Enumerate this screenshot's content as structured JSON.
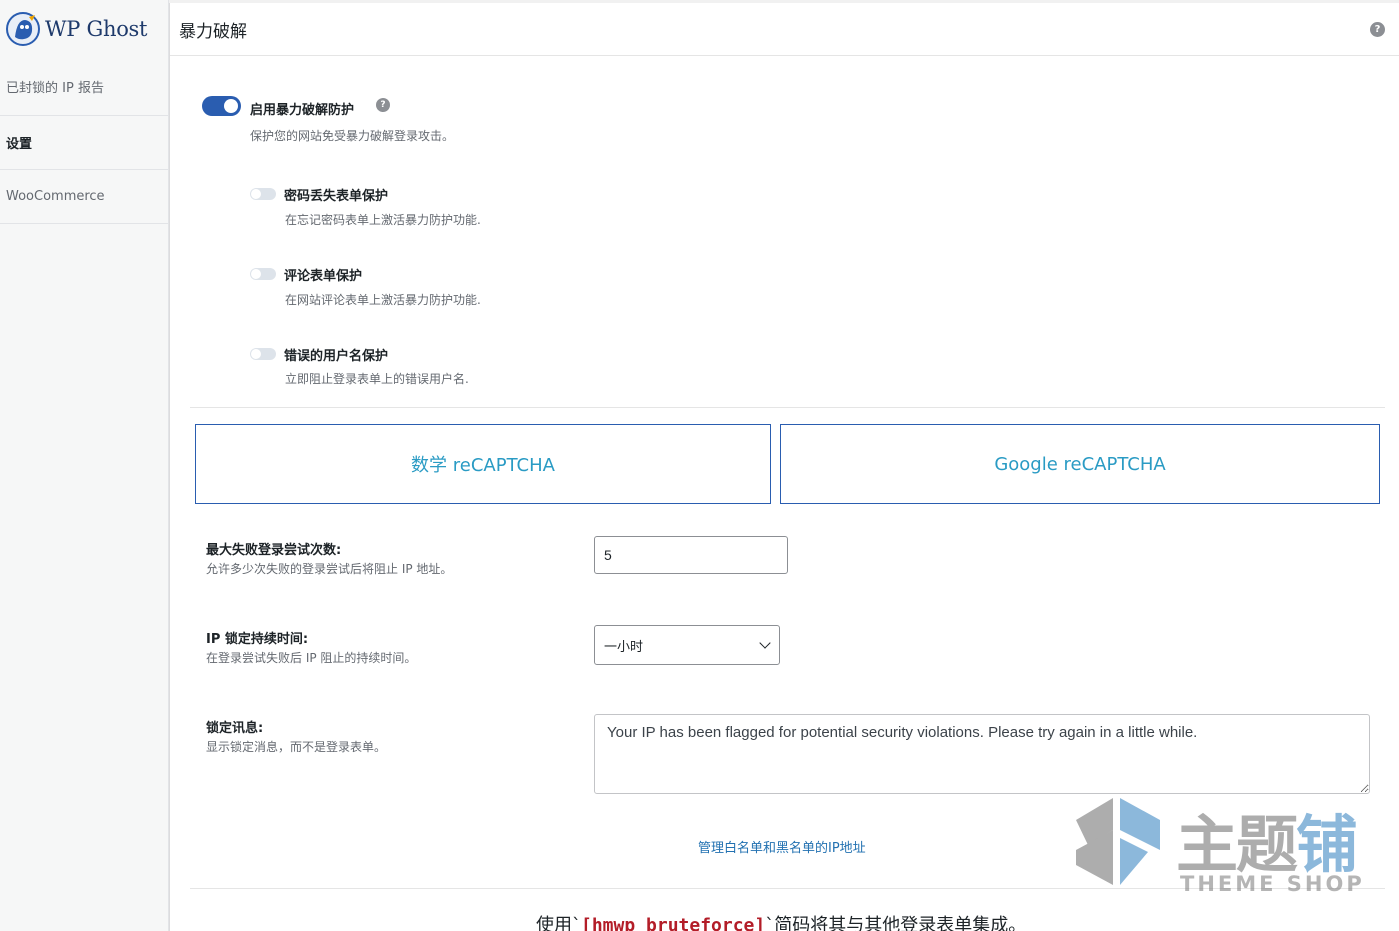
{
  "brand": {
    "name": "WP Ghost"
  },
  "sidebar": {
    "items": [
      {
        "label": "已封锁的 IP 报告"
      },
      {
        "label": "设置"
      },
      {
        "label": "WooCommerce"
      }
    ]
  },
  "header": {
    "title": "暴力破解",
    "help": "?"
  },
  "main_toggle": {
    "title": "启用暴力破解防护",
    "description": "保护您的网站免受暴力破解登录攻击。",
    "enabled": true
  },
  "sub_options": [
    {
      "title": "密码丢失表单保护",
      "description": "在忘记密码表单上激活暴力防护功能.",
      "enabled": false
    },
    {
      "title": "评论表单保护",
      "description": "在网站评论表单上激活暴力防护功能.",
      "enabled": false
    },
    {
      "title": "错误的用户名保护",
      "description": "立即阻止登录表单上的错误用户名.",
      "enabled": false
    }
  ],
  "captcha_tabs": [
    {
      "label": "数学 reCAPTCHA"
    },
    {
      "label": "Google reCAPTCHA"
    }
  ],
  "fields": {
    "max_attempts": {
      "label": "最大失败登录尝试次数:",
      "description": "允许多少次失败的登录尝试后将阻止 IP 地址。",
      "value": "5"
    },
    "lockout_duration": {
      "label": "IP 锁定持续时间:",
      "description": "在登录尝试失败后 IP 阻止的持续时间。",
      "selected": "一小时"
    },
    "lockout_message": {
      "label": "锁定讯息:",
      "description": "显示锁定消息，而不是登录表单。",
      "value": "Your IP has been flagged for potential security violations. Please try again in a little while."
    }
  },
  "links": {
    "manage_ips": "管理白名单和黑名单的IP地址"
  },
  "shortcode": {
    "prefix": "使用`",
    "code": "[hmwp_bruteforce]",
    "suffix": "`简码将其与其他登录表单集成。"
  },
  "watermark": {
    "cn_a": "主题",
    "cn_b": "铺",
    "en": "THEME SHOP"
  },
  "colors": {
    "accent": "#2a5db0",
    "tab_text": "#2a9bc4",
    "link": "#2271b1",
    "code": "#b31d28"
  }
}
